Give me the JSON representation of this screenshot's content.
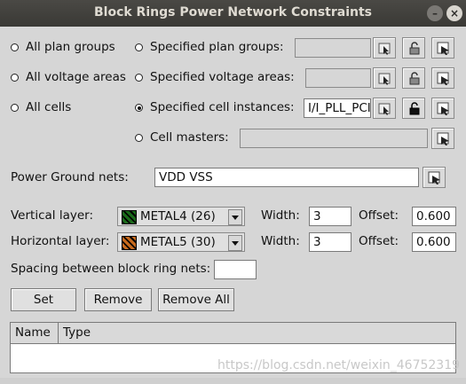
{
  "window": {
    "title": "Block Rings Power Network Constraints",
    "minimize": "–",
    "close": "×"
  },
  "options": {
    "all_plan_groups": "All plan groups",
    "specified_plan_groups": "Specified plan groups:",
    "all_voltage_areas": "All voltage areas",
    "specified_voltage_areas": "Specified voltage areas:",
    "all_cells": "All cells",
    "specified_cell_instances": "Specified cell instances:",
    "cell_instances_value": "I/I_PLL_PCI",
    "cell_masters": "Cell masters:"
  },
  "power_ground": {
    "label": "Power Ground nets:",
    "value": "VDD VSS"
  },
  "vertical": {
    "label": "Vertical layer:",
    "layer": "METAL4 (26)",
    "swatch_color": "#1a6b1a",
    "width_label": "Width:",
    "width": "3",
    "offset_label": "Offset:",
    "offset": "0.600"
  },
  "horizontal": {
    "label": "Horizontal layer:",
    "layer": "METAL5 (30)",
    "swatch_color": "#c86a1e",
    "width_label": "Width:",
    "width": "3",
    "offset_label": "Offset:",
    "offset": "0.600"
  },
  "spacing": {
    "label": "Spacing between block ring nets:",
    "value": ""
  },
  "buttons": {
    "set": "Set",
    "remove": "Remove",
    "remove_all": "Remove All"
  },
  "table": {
    "columns": [
      "Name",
      "Type"
    ]
  },
  "watermark": "https://blog.csdn.net/weixin_46752319"
}
